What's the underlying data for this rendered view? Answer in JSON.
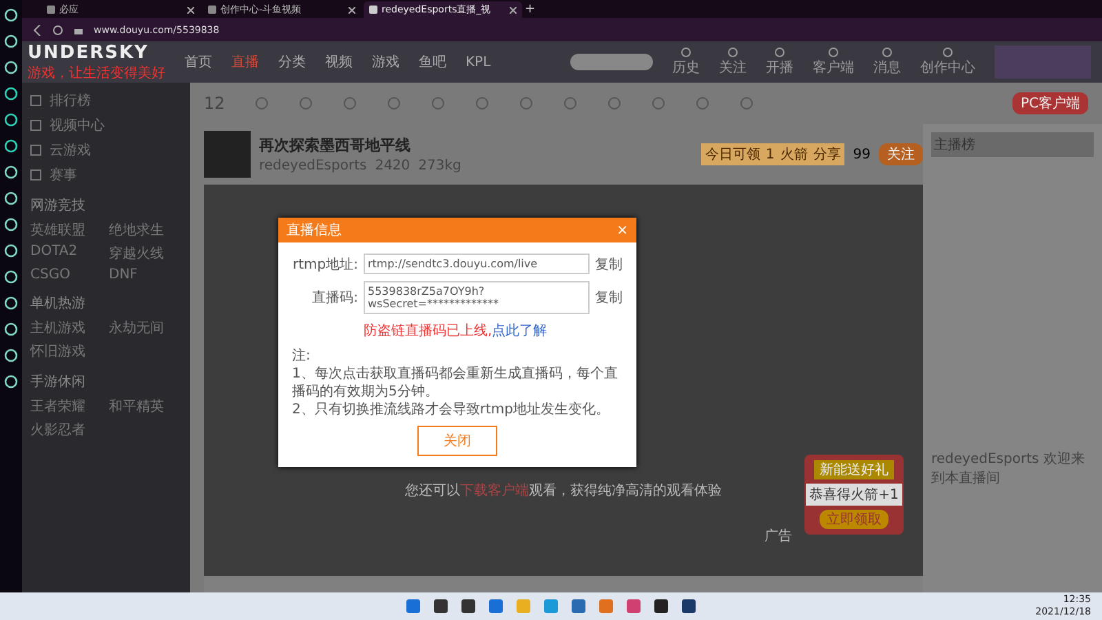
{
  "browser": {
    "tabs": [
      {
        "label": "必应",
        "selected": false
      },
      {
        "label": "创作中心-斗鱼视频",
        "selected": false
      },
      {
        "label": "redeyedEsports直播_视",
        "selected": true
      }
    ],
    "new_tab": "+",
    "url": "www.douyu.com/5539838"
  },
  "site_header": {
    "logo": "UNDERSKY",
    "tagline": "游戏，让生活变得美好",
    "nav": [
      {
        "label": "首页",
        "selected": false
      },
      {
        "label": "直播",
        "selected": true
      },
      {
        "label": "分类",
        "selected": false
      },
      {
        "label": "视频",
        "selected": false
      },
      {
        "label": "游戏",
        "selected": false
      },
      {
        "label": "鱼吧",
        "selected": false
      },
      {
        "label": "KPL",
        "selected": false
      }
    ],
    "user_links": [
      "历史",
      "关注",
      "开播",
      "客户端",
      "消息",
      "创作中心"
    ]
  },
  "sidebar": {
    "links": [
      "排行榜",
      "视频中心",
      "云游戏",
      "赛事"
    ],
    "sections": [
      {
        "title": "网游竞技",
        "items": [
          "英雄联盟",
          "绝地求生",
          "DOTA2",
          "穿越火线",
          "CSGO",
          "DNF"
        ]
      },
      {
        "title": "单机热游",
        "items": [
          "主机游戏",
          "永劫无间",
          "怀旧游戏"
        ]
      },
      {
        "title": "手游休闲",
        "items": [
          "王者荣耀",
          "和平精英",
          "火影忍者"
        ]
      }
    ]
  },
  "toolbar": {
    "level": "12",
    "client": "PC客户端"
  },
  "room": {
    "title": "再次探索墨西哥地平线",
    "streamer": "redeyedEsports",
    "heat": "2420",
    "weight": "273kg",
    "follow_count": "99",
    "follow": "关注",
    "rocket_label": "今日可领",
    "rocket_count": "1",
    "rocket_unit": "火箭",
    "share": "分享"
  },
  "player": {
    "hint_before": "您还可以",
    "hint_link": "下载客户端",
    "hint_after": "观看，获得纯净高清的观看体验",
    "ad": "广告",
    "promo": {
      "title": "新能送好礼",
      "message": "恭喜得火箭+1",
      "button": "立即领取"
    }
  },
  "chat": {
    "rank": "主播榜",
    "welcome_user": "redeyedEsports",
    "welcome": "欢迎来到本直播间"
  },
  "modal": {
    "title": "直播信息",
    "close": "×",
    "fields": [
      {
        "label": "rtmp地址:",
        "value": "rtmp://sendtc3.douyu.com/live",
        "copy": "复制"
      },
      {
        "label": "直播码:",
        "value": "5539838rZ5a7OY9h?wsSecret=*************",
        "copy": "复制"
      }
    ],
    "warning": "防盗链直播码已上线,",
    "learn_more": "点此了解",
    "note_title": "注:",
    "notes": [
      "1、每次点击获取直播码都会重新生成直播码，每个直播码的有效期为5分钟。",
      "2、只有切换推流线路才会导致rtmp地址发生变化。"
    ],
    "button": "关闭"
  },
  "taskbar": {
    "time": "12:35",
    "date": "2021/12/18"
  }
}
